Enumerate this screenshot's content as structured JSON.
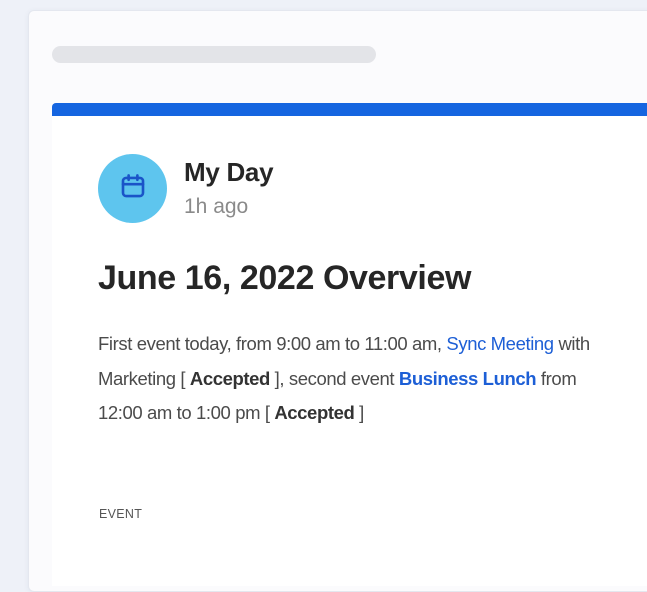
{
  "notification": {
    "source_name": "My Day",
    "source_icon": "calendar-icon",
    "timestamp": "1h ago",
    "headline": "June 16, 2022 Overview",
    "description": {
      "part1": "First event today, from 9:00 am to 11:00 am, ",
      "event1_link": "Sync Meeting",
      "part2": " with Marketing [ ",
      "event1_status": "Accepted",
      "part3": " ], second event ",
      "event2_link": "Business Lunch",
      "part4": " from 12:00 am to 1:00 pm [ ",
      "event2_status": "Accepted",
      "part5": " ]"
    },
    "category": "EVENT"
  },
  "colors": {
    "accent": "#1565e0",
    "avatar_bg": "#5ec5ee",
    "link": "#1d5fd6"
  }
}
